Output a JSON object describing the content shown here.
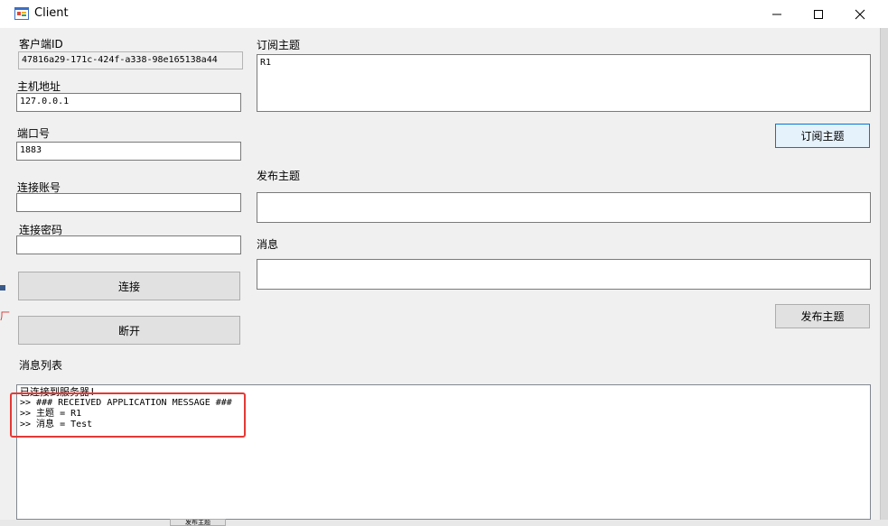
{
  "window": {
    "title": "Client"
  },
  "client_id": {
    "label": "客户端ID",
    "value": "47816a29-171c-424f-a338-98e165138a44"
  },
  "host": {
    "label": "主机地址",
    "value": "127.0.0.1"
  },
  "port": {
    "label": "端口号",
    "value": "1883"
  },
  "username": {
    "label": "连接账号",
    "value": ""
  },
  "password": {
    "label": "连接密码",
    "value": ""
  },
  "buttons": {
    "connect": "连接",
    "disconnect": "断开",
    "subscribe": "订阅主题",
    "publish": "发布主题"
  },
  "subscribe_topic": {
    "label": "订阅主题",
    "value": "R1"
  },
  "publish_topic": {
    "label": "发布主题",
    "value": ""
  },
  "message": {
    "label": "消息",
    "value": ""
  },
  "message_list": {
    "label": "消息列表",
    "lines": [
      "已连接到服务器!",
      ">> ### RECEIVED APPLICATION MESSAGE ###",
      ">> 主题 = R1",
      ">> 消息 = Test"
    ]
  },
  "background_app": {
    "fragment_label": "发布主题",
    "fragment_char": "厂"
  },
  "colors": {
    "highlight": "#e53935",
    "focus_border": "#0078d7"
  }
}
